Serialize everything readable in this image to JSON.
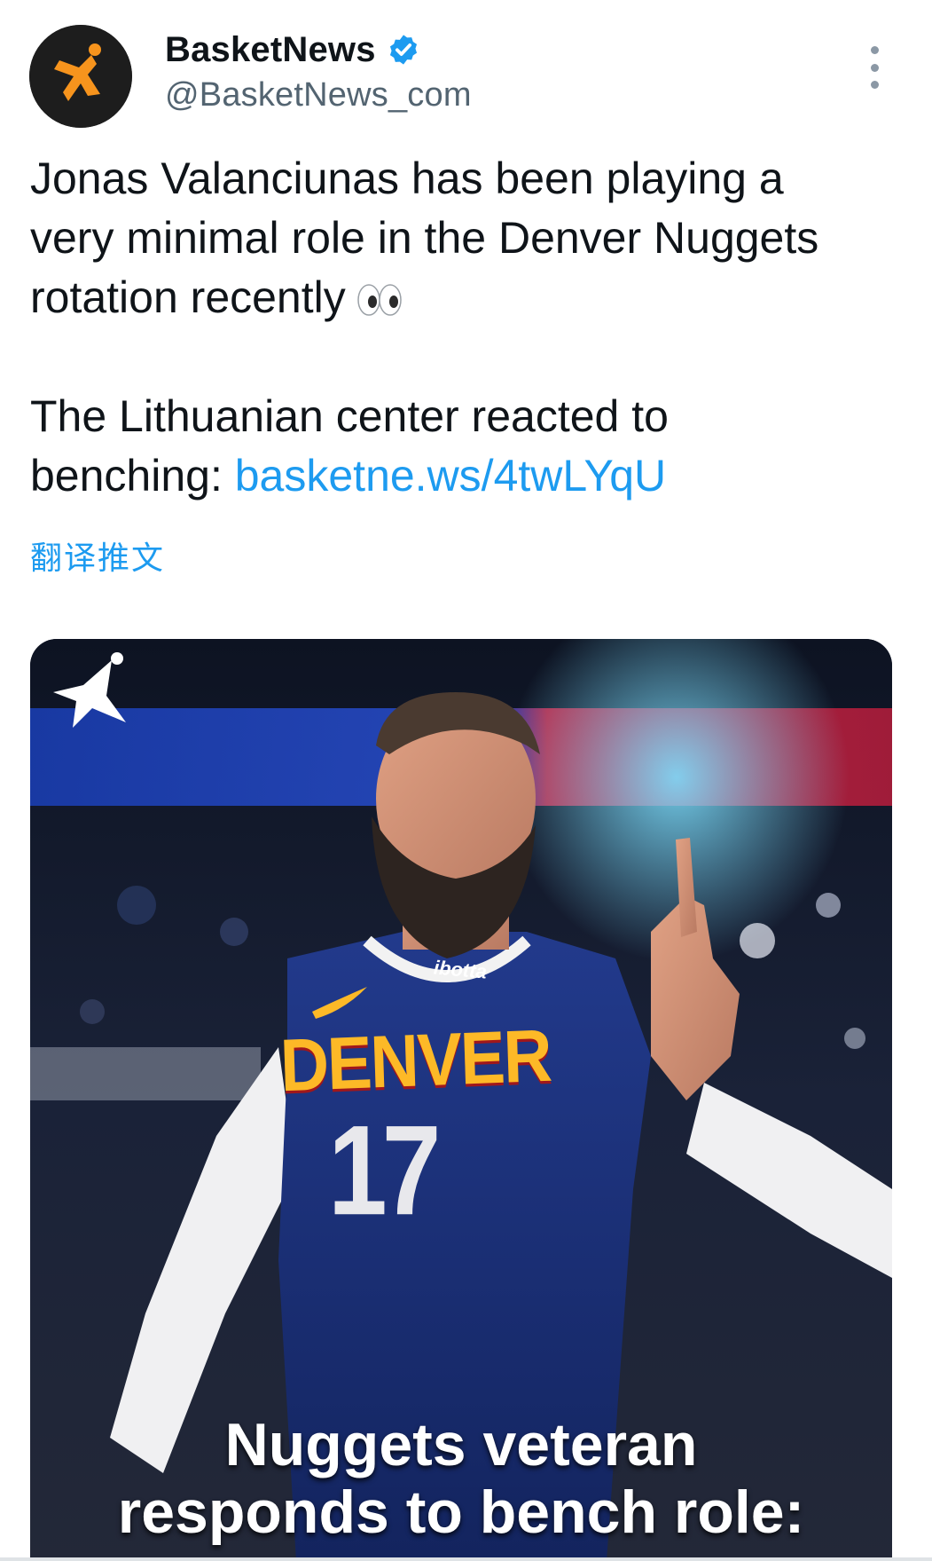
{
  "account": {
    "display_name": "BasketNews",
    "handle": "@BasketNews_com",
    "verified": true,
    "avatar_icon": "basketnews-logo-icon"
  },
  "tweet": {
    "line1": "Jonas Valanciunas has been playing a",
    "line2": "very minimal role in the Denver Nuggets",
    "line3": "rotation recently",
    "emoji": "eyes",
    "line4": "The Lithuanian center reacted to",
    "line5_prefix": "benching: ",
    "link_text": "basketne.ws/4twLYqU"
  },
  "translate_label": "翻译推文",
  "media": {
    "jersey_team": "DENVER",
    "jersey_number": "17",
    "jersey_sponsor": "ibotta",
    "caption_line1": "Nuggets veteran",
    "caption_line2": "responds to bench role:"
  },
  "colors": {
    "link": "#1d9bf0",
    "verified": "#1d9bf0",
    "brand_orange": "#f7941d",
    "secondary_text": "#536471"
  }
}
